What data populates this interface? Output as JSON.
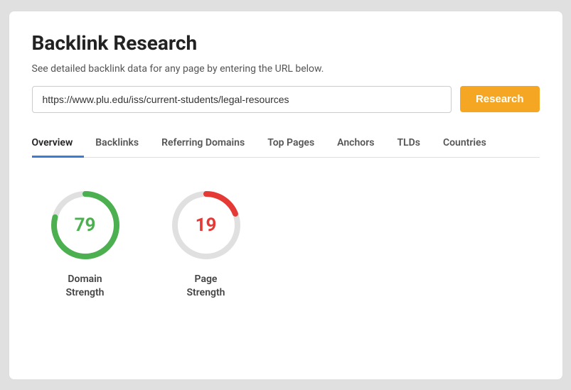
{
  "page": {
    "title": "Backlink Research",
    "subtitle": "See detailed backlink data for any page by entering the URL below."
  },
  "search": {
    "url_value": "https://www.plu.edu/iss/current-students/legal-resources",
    "url_placeholder": "Enter a URL",
    "button_label": "Research"
  },
  "tabs": [
    {
      "id": "overview",
      "label": "Overview",
      "active": true
    },
    {
      "id": "backlinks",
      "label": "Backlinks",
      "active": false
    },
    {
      "id": "referring-domains",
      "label": "Referring Domains",
      "active": false
    },
    {
      "id": "top-pages",
      "label": "Top Pages",
      "active": false
    },
    {
      "id": "anchors",
      "label": "Anchors",
      "active": false
    },
    {
      "id": "tlds",
      "label": "TLDs",
      "active": false
    },
    {
      "id": "countries",
      "label": "Countries",
      "active": false
    }
  ],
  "metrics": [
    {
      "id": "domain-strength",
      "value": "79",
      "label": "Domain\nStrength",
      "color": "#4caf50",
      "bg_color": "#e0e0e0",
      "percent": 79,
      "value_class": "green-value"
    },
    {
      "id": "page-strength",
      "value": "19",
      "label": "Page\nStrength",
      "color": "#e53935",
      "bg_color": "#e0e0e0",
      "percent": 19,
      "value_class": "red-value"
    }
  ],
  "colors": {
    "accent_orange": "#f5a623",
    "active_tab_blue": "#3a7bd5",
    "green": "#4caf50",
    "red": "#e53935",
    "track": "#e0e0e0"
  }
}
